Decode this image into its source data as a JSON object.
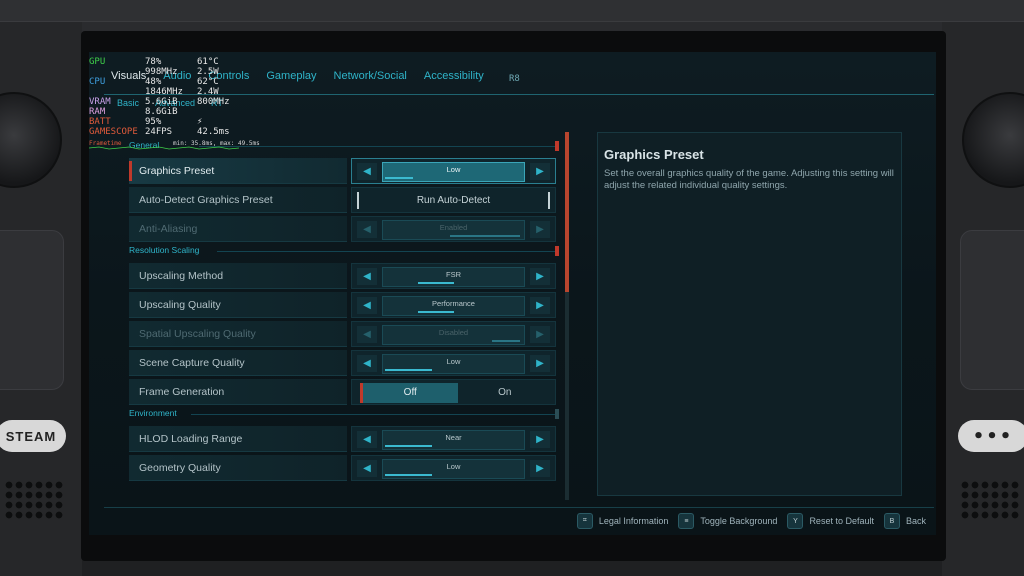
{
  "device": {
    "steam_label": "STEAM",
    "dots_label": "•••"
  },
  "nav": {
    "tabs": [
      "Visuals",
      "Audio",
      "Controls",
      "Gameplay",
      "Network/Social",
      "Accessibility"
    ],
    "active_tab": "Visuals",
    "badge": "R8"
  },
  "sub_tabs": [
    "Basic",
    "Advanced",
    "RT"
  ],
  "sections": {
    "general": "General",
    "resolution": "Resolution Scaling",
    "environment": "Environment"
  },
  "rows": {
    "graphics_preset": {
      "label": "Graphics Preset",
      "value": "Low",
      "level": 0.2
    },
    "auto_detect": {
      "label": "Auto-Detect Graphics Preset",
      "button": "Run Auto-Detect"
    },
    "anti_aliasing": {
      "label": "Anti-Aliasing",
      "value": "Enabled",
      "level": 0.5
    },
    "upscaling_method": {
      "label": "Upscaling Method",
      "value": "FSR",
      "level": 0.25
    },
    "upscaling_quality": {
      "label": "Upscaling Quality",
      "value": "Performance",
      "level": 0.25
    },
    "spatial_upscaling": {
      "label": "Spatial Upscaling Quality",
      "value": "Disabled",
      "level": 0.2
    },
    "scene_capture": {
      "label": "Scene Capture Quality",
      "value": "Low",
      "level": 0.33
    },
    "frame_generation": {
      "label": "Frame Generation",
      "off": "Off",
      "on": "On"
    },
    "hlod": {
      "label": "HLOD Loading Range",
      "value": "Near",
      "level": 0.33
    },
    "geometry": {
      "label": "Geometry Quality",
      "value": "Low",
      "level": 0.33
    }
  },
  "info": {
    "title": "Graphics Preset",
    "description": "Set the overall graphics quality of the game. Adjusting this setting will adjust the related individual quality settings."
  },
  "footer": [
    {
      "key": "⌗",
      "label": "Legal Information"
    },
    {
      "key": "≡",
      "label": "Toggle Background"
    },
    {
      "key": "Y",
      "label": "Reset to Default"
    },
    {
      "key": "B",
      "label": "Back"
    }
  ],
  "overlay": {
    "gpu": {
      "label": "GPU",
      "v1": "78%",
      "v2": "61°C",
      "color": "#3fd04a"
    },
    "gpu2": {
      "v1": "998MHz",
      "v2": "2.5W"
    },
    "cpu": {
      "label": "CPU",
      "v1": "48%",
      "v2": "62°C",
      "color": "#3fa0e0"
    },
    "cpu2": {
      "v1": "1846MHz",
      "v2": "2.4W"
    },
    "vram": {
      "label": "VRAM",
      "v1": "5.6GiB",
      "v2": "800MHz",
      "color": "#c8a0e8"
    },
    "ram": {
      "label": "RAM",
      "v1": "8.6GiB",
      "color": "#e0a0e0"
    },
    "batt": {
      "label": "BATT",
      "v1": "95%",
      "v2": "⚡",
      "color": "#e05a3b"
    },
    "gamescope": {
      "label": "GAMESCOPE",
      "v1": "24FPS",
      "v2": "42.5ms",
      "color": "#e05a3b"
    },
    "frametime_label": "Frametime",
    "frametime_stats": "min: 35.8ms, max: 49.5ms"
  }
}
